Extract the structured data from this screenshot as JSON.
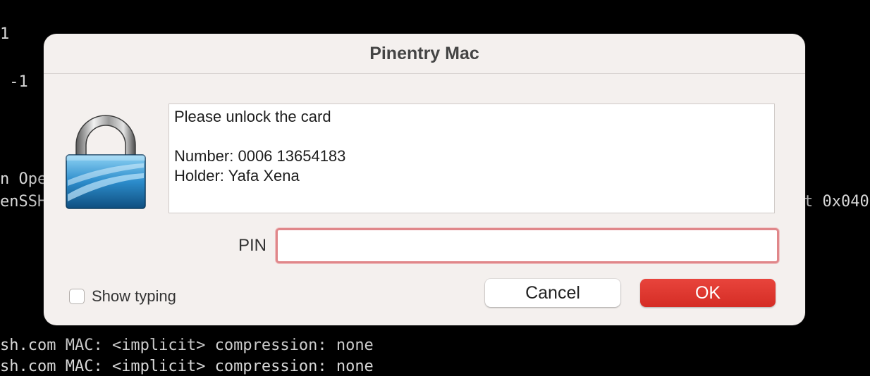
{
  "terminal": {
    "line1": "1",
    "line2": " -1",
    "line3": "n Ope",
    "line4": "enSSH",
    "line5": "t 0x040",
    "line6": "sh.com MAC: <implicit> compression: none",
    "line7": "sh.com MAC: <implicit> compression: none"
  },
  "dialog": {
    "title": "Pinentry Mac",
    "message": {
      "line1": "Please unlock the card",
      "line2": "",
      "line3": "Number: 0006 13654183",
      "line4": "Holder: Yafa Xena"
    },
    "pin_label": "PIN",
    "pin_value": "",
    "show_typing_label": "Show typing",
    "show_typing_checked": false,
    "cancel_label": "Cancel",
    "ok_label": "OK",
    "icon": "padlock-icon"
  },
  "colors": {
    "ok_button": "#dc352d",
    "pin_focus_ring": "#e0878a",
    "dialog_background": "#f4f0ee"
  }
}
